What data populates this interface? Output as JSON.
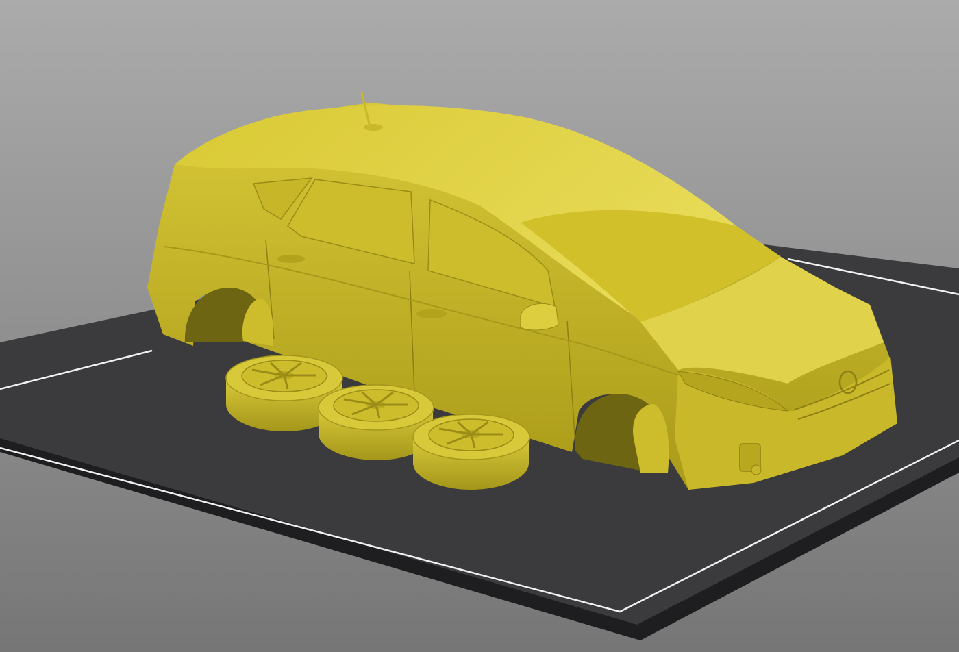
{
  "viewport": {
    "background_top": "#a9a9a9",
    "background_bottom": "#7a7a7a"
  },
  "build_plate": {
    "surface_color": "#3b3b3d",
    "edge_color": "#1f1f21",
    "outline_color": "#f2f2f2"
  },
  "model": {
    "body_color": "#d6c42a",
    "highlight_color": "#ece05a",
    "shadow_color": "#9e8f16",
    "object_count": 4,
    "parts": [
      "car-body",
      "wheel",
      "wheel",
      "wheel"
    ]
  }
}
